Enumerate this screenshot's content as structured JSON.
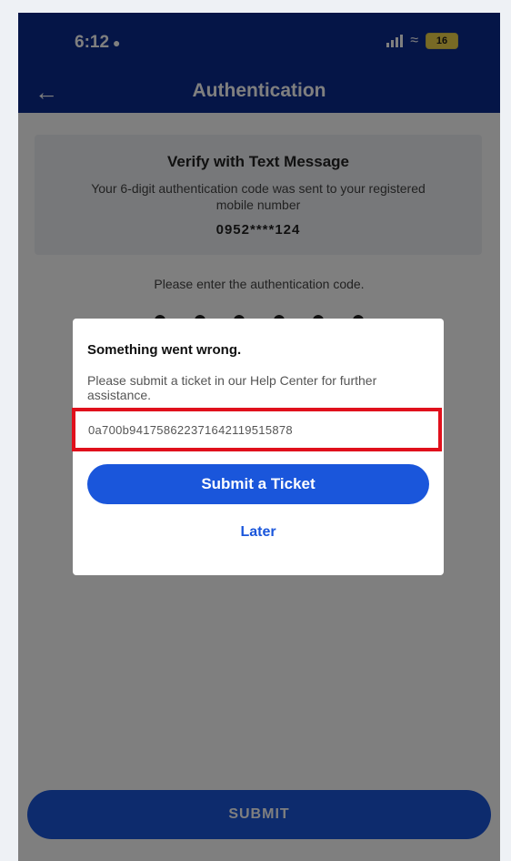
{
  "status_bar": {
    "time": "6:12",
    "battery": "16"
  },
  "header": {
    "back_icon": "arrow-left-icon",
    "title": "Authentication"
  },
  "verify_card": {
    "title": "Verify with Text Message",
    "description": "Your 6-digit authentication code was sent to your registered mobile number",
    "phone_number": "0952****124"
  },
  "code_entry": {
    "prompt": "Please enter the authentication code."
  },
  "footer": {
    "submit_label": "SUBMIT"
  },
  "error_dialog": {
    "title": "Something went wrong.",
    "message": "Please submit a ticket in our Help Center for further assistance.",
    "ticket_id": "0a700b9417586223716421195​15878",
    "submit_ticket_label": "Submit a Ticket",
    "later_label": "Later"
  },
  "colors": {
    "header_blue": "#0b2a8f",
    "button_blue": "#1a56db",
    "highlight_red": "#e0101c"
  }
}
